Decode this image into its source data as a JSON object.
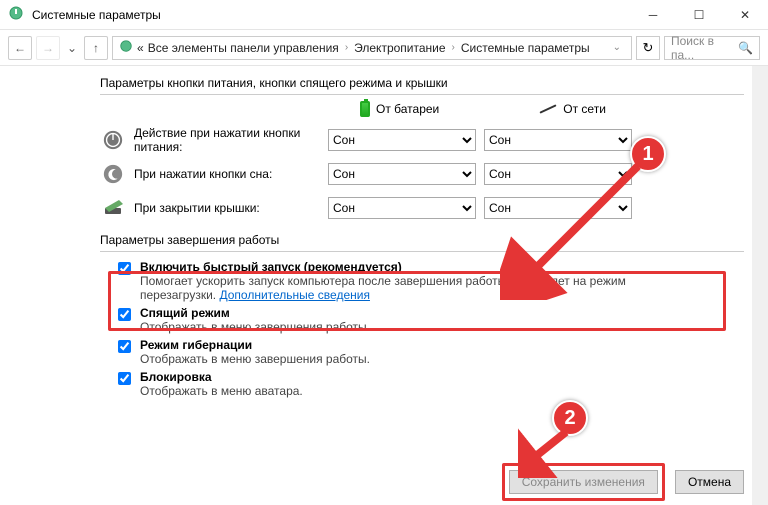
{
  "window": {
    "title": "Системные параметры"
  },
  "breadcrumb": {
    "prefix_mark": "«",
    "c1": "Все элементы панели управления",
    "c2": "Электропитание",
    "c3": "Системные параметры"
  },
  "search": {
    "placeholder": "Поиск в па..."
  },
  "group1": {
    "title": "Параметры кнопки питания, кнопки спящего режима и крышки"
  },
  "columns": {
    "battery": "От батареи",
    "mains": "От сети"
  },
  "rows": {
    "power_button": {
      "label": "Действие при нажатии кнопки питания:",
      "bat": "Сон",
      "ac": "Сон"
    },
    "sleep_button": {
      "label": "При нажатии кнопки сна:",
      "bat": "Сон",
      "ac": "Сон"
    },
    "lid_close": {
      "label": "При закрытии крышки:",
      "bat": "Сон",
      "ac": "Сон"
    }
  },
  "select_options": [
    "Сон"
  ],
  "group2": {
    "title": "Параметры завершения работы"
  },
  "checks": {
    "fast_startup": {
      "title": "Включить быстрый запуск (рекомендуется)",
      "desc_prefix": "Помогает ускорить запуск компьютера после завершения работы. Не влияет на режим перезагрузки. ",
      "link": "Дополнительные сведения"
    },
    "sleep": {
      "title": "Спящий режим",
      "desc": "Отображать в меню завершения работы."
    },
    "hibernate": {
      "title": "Режим гибернации",
      "desc": "Отображать в меню завершения работы."
    },
    "lock": {
      "title": "Блокировка",
      "desc": "Отображать в меню аватара."
    }
  },
  "buttons": {
    "save": "Сохранить изменения",
    "cancel": "Отмена"
  },
  "callouts": {
    "one": "1",
    "two": "2"
  }
}
